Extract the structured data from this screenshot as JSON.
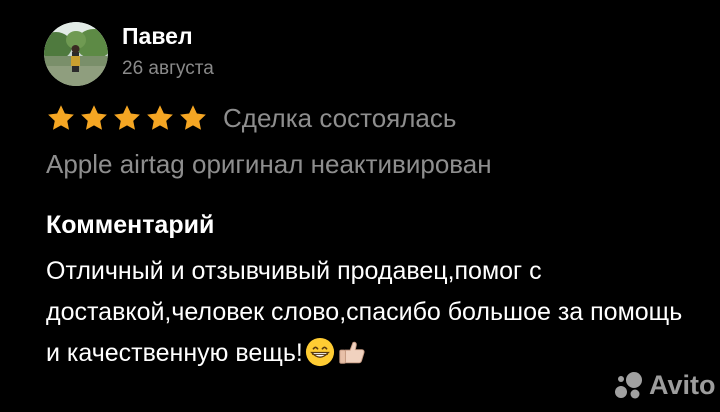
{
  "review": {
    "author": "Павел",
    "date": "26 августа",
    "rating": 5,
    "rating_max": 5,
    "deal_status": "Сделка состоялась",
    "item_title": "Apple airtag оригинал неактивирован",
    "comment_heading": "Комментарий",
    "comment_text": "Отличный и отзывчивый продавец,помог с доставкой,человек слово,спасибо большое за помощь и качественную вещь!",
    "comment_emojis": [
      "grinning-face-emoji",
      "thumbs-up-emoji"
    ],
    "avatar_icon": "user-avatar-photo"
  },
  "watermark": {
    "brand": "Avito",
    "logo_icon": "avito-logo-icon"
  },
  "colors": {
    "background": "#000000",
    "text_primary": "#ffffff",
    "text_secondary": "#8e8e8e",
    "star": "#f5a623"
  }
}
